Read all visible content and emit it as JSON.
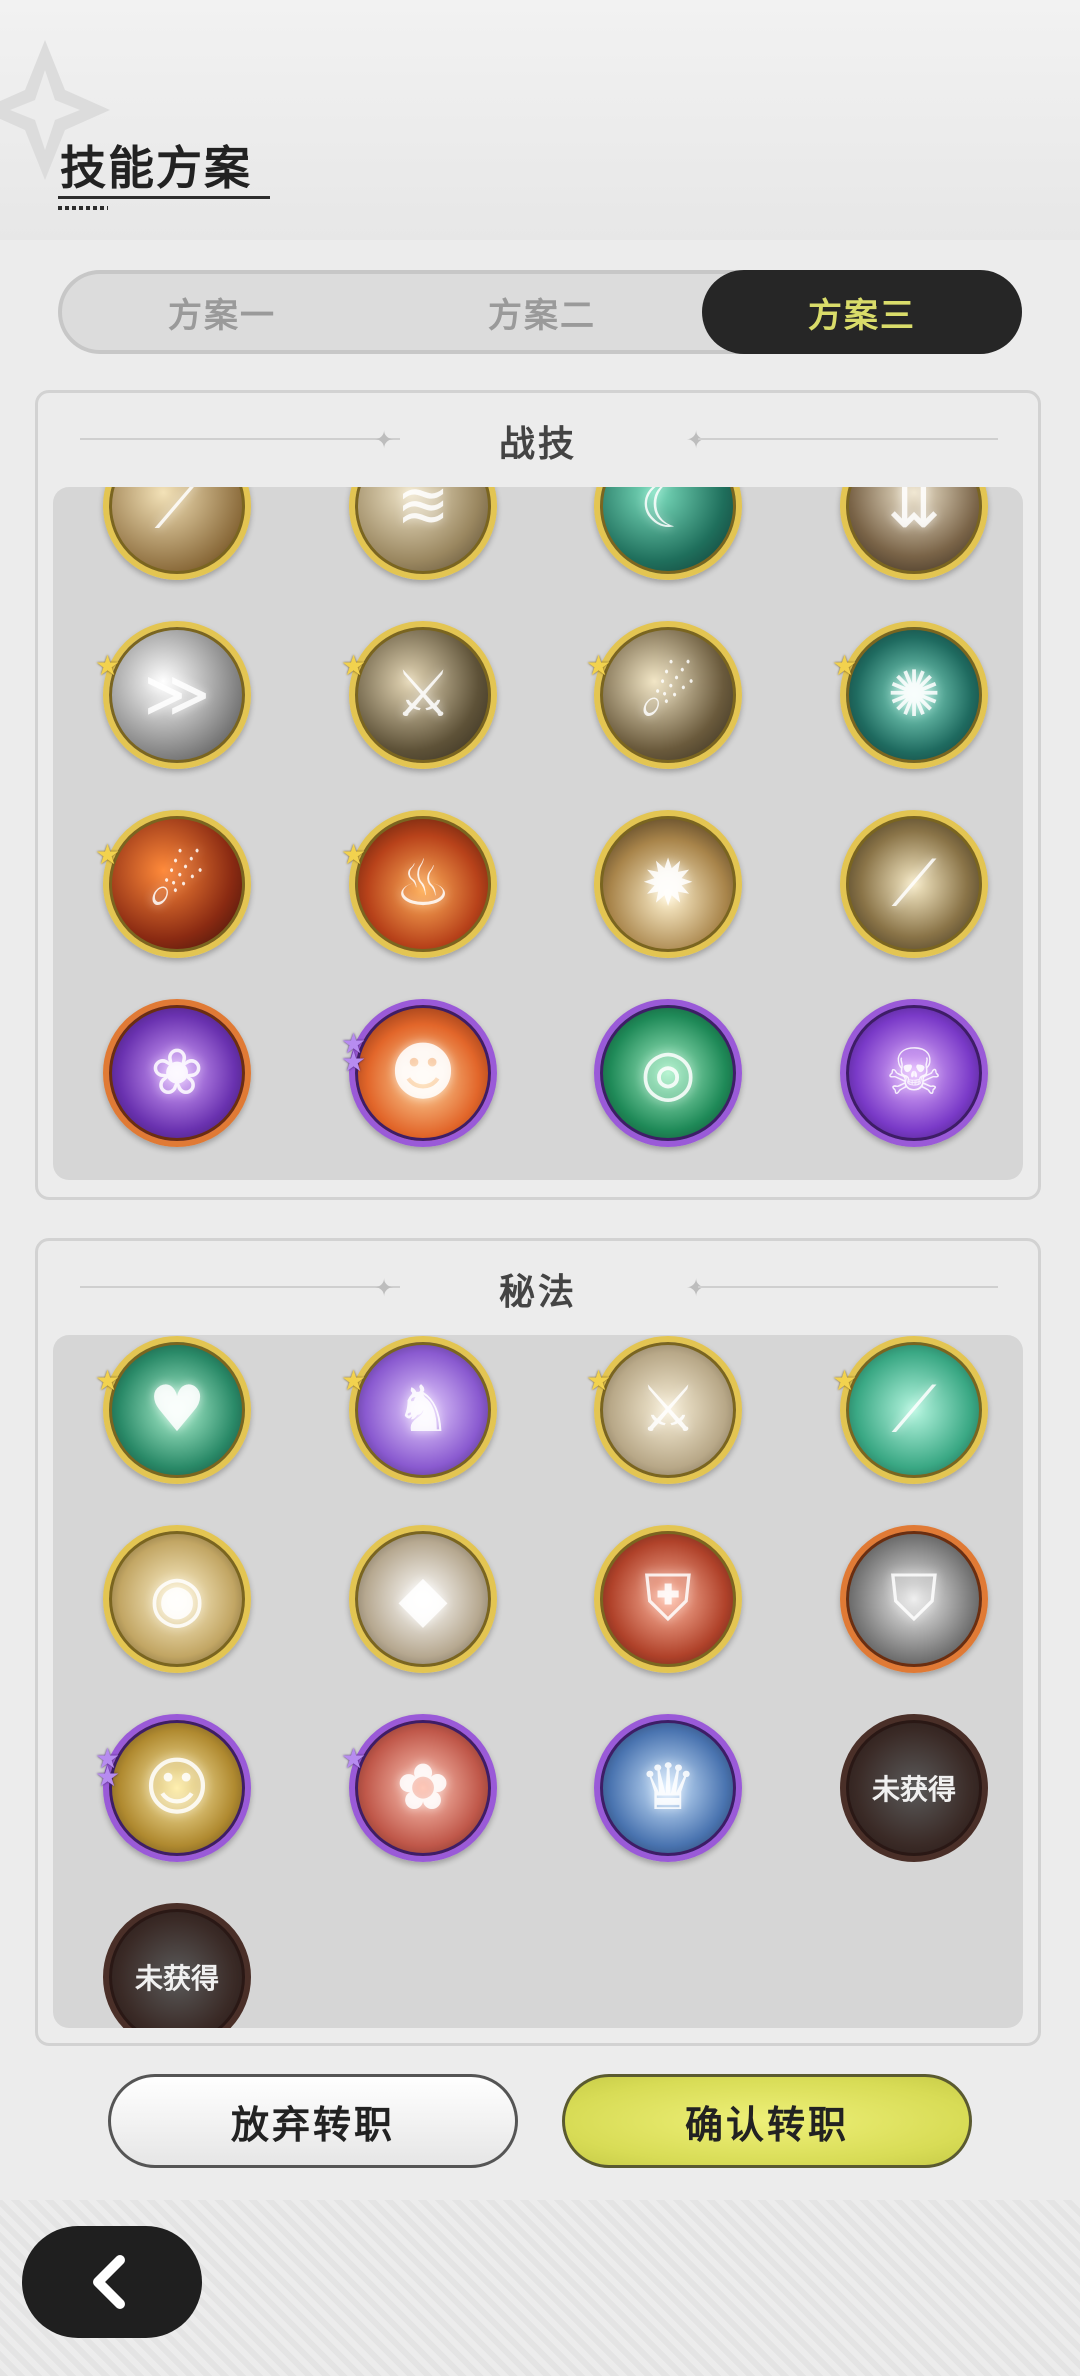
{
  "page": {
    "title": "技能方案"
  },
  "tabs": [
    {
      "label": "方案一",
      "active": false
    },
    {
      "label": "方案二",
      "active": false
    },
    {
      "label": "方案三",
      "active": true
    }
  ],
  "combat_skills": {
    "title": "战技",
    "items": [
      {
        "icon": "claw-slash-skill-icon",
        "rarity": "gold",
        "stars": 1
      },
      {
        "icon": "whirlwind-skill-icon",
        "rarity": "gold",
        "stars": 1
      },
      {
        "icon": "crescent-wave-skill-icon",
        "rarity": "gold",
        "stars": 1
      },
      {
        "icon": "sword-rain-skill-icon",
        "rarity": "gold",
        "stars": 1
      },
      {
        "icon": "phantom-dash-skill-icon",
        "rarity": "gold",
        "stars": 1
      },
      {
        "icon": "sword-thrust-skill-icon",
        "rarity": "gold",
        "stars": 1
      },
      {
        "icon": "leap-strike-skill-icon",
        "rarity": "gold",
        "stars": 1
      },
      {
        "icon": "spider-web-skill-icon",
        "rarity": "gold",
        "stars": 1
      },
      {
        "icon": "fire-slash-skill-icon",
        "rarity": "gold",
        "stars": 1
      },
      {
        "icon": "flame-ring-skill-icon",
        "rarity": "gold",
        "stars": 1
      },
      {
        "icon": "ground-burst-skill-icon",
        "rarity": "gold",
        "stars": 0
      },
      {
        "icon": "light-slash-skill-icon",
        "rarity": "gold",
        "stars": 0
      },
      {
        "icon": "thorn-rose-skill-icon",
        "rarity": "orange",
        "stars": 0
      },
      {
        "icon": "fire-spirit-skill-icon",
        "rarity": "purple",
        "stars": 2
      },
      {
        "icon": "wind-vortex-skill-icon",
        "rarity": "purple",
        "stars": 0
      },
      {
        "icon": "ghost-face-skill-icon",
        "rarity": "purple",
        "stars": 0
      }
    ]
  },
  "secret_arts": {
    "title": "秘法",
    "locked_label": "未获得",
    "items": [
      {
        "icon": "heal-heart-skill-icon",
        "rarity": "gold",
        "stars": 1
      },
      {
        "icon": "wolf-spirit-skill-icon",
        "rarity": "gold",
        "stars": 1
      },
      {
        "icon": "sword-buff-skill-icon",
        "rarity": "gold",
        "stars": 1
      },
      {
        "icon": "emerald-blade-skill-icon",
        "rarity": "gold",
        "stars": 1
      },
      {
        "icon": "all-seeing-eye-skill-icon",
        "rarity": "gold",
        "stars": 0
      },
      {
        "icon": "crystal-shard-skill-icon",
        "rarity": "gold",
        "stars": 0
      },
      {
        "icon": "armor-skill-icon",
        "rarity": "gold",
        "stars": 0
      },
      {
        "icon": "shield-guard-skill-icon",
        "rarity": "orange",
        "stars": 0
      },
      {
        "icon": "golden-aura-skill-icon",
        "rarity": "purple",
        "stars": 2
      },
      {
        "icon": "blood-cloud-skill-icon",
        "rarity": "purple",
        "stars": 1
      },
      {
        "icon": "ice-crown-skill-icon",
        "rarity": "purple",
        "stars": 0
      },
      {
        "icon": "locked-skill-icon",
        "rarity": "locked",
        "stars": 0
      },
      {
        "icon": "locked-skill-icon",
        "rarity": "locked",
        "stars": 0
      }
    ]
  },
  "buttons": {
    "cancel": "放弃转职",
    "confirm": "确认转职"
  },
  "back": {
    "icon": "chevron-left-icon"
  },
  "colors": {
    "accent": "#d9dc6a",
    "tab_active_bg": "#262626",
    "confirm_bg": "#dfe25d",
    "gold_border": "#e3c552",
    "purple_border": "#9a5ad8",
    "orange_border": "#e07a35"
  }
}
